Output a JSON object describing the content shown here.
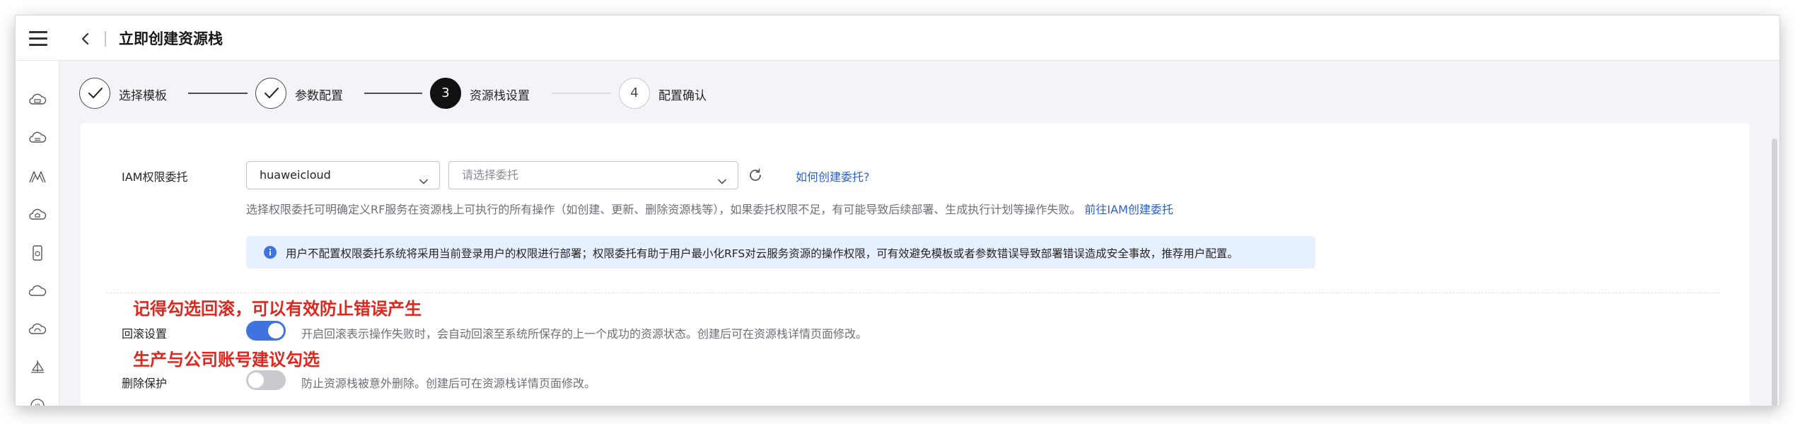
{
  "header": {
    "title": "立即创建资源栈",
    "menu_icon": "hamburger-menu-icon",
    "back_icon": "chevron-left-icon"
  },
  "sidebar": {
    "items": [
      {
        "icon": "cloud-server-icon"
      },
      {
        "icon": "cloud-database-icon"
      },
      {
        "icon": "mountain-icon"
      },
      {
        "icon": "cloud-home-icon"
      },
      {
        "icon": "device-icon"
      },
      {
        "icon": "cloud-outline-icon"
      },
      {
        "icon": "cloud-gear-icon"
      },
      {
        "icon": "sailboat-icon"
      },
      {
        "icon": "ip-icon"
      }
    ]
  },
  "steps": [
    {
      "number": "1",
      "label": "选择模板",
      "state": "done"
    },
    {
      "number": "2",
      "label": "参数配置",
      "state": "done"
    },
    {
      "number": "3",
      "label": "资源栈设置",
      "state": "current"
    },
    {
      "number": "4",
      "label": "配置确认",
      "state": "pending"
    }
  ],
  "iam": {
    "label": "IAM权限委托",
    "provider_value": "huaweicloud",
    "agency_placeholder": "请选择委托",
    "how_to_link": "如何创建委托?",
    "hint": "选择权限委托可明确定义RF服务在资源栈上可执行的所有操作（如创建、更新、删除资源栈等），如果委托权限不足，有可能导致后续部署、生成执行计划等操作失败。",
    "hint_link": "前往IAM创建委托",
    "info": "用户不配置权限委托系统将采用当前登录用户的权限进行部署；权限委托有助于用户最小化RFS对云服务资源的操作权限，可有效避免模板或者参数错误导致部署错误造成安全事故，推荐用户配置。"
  },
  "rollback": {
    "annotation": "记得勾选回滚，可以有效防止错误产生",
    "label": "回滚设置",
    "enabled": true,
    "description": "开启回滚表示操作失败时，会自动回滚至系统所保存的上一个成功的资源状态。创建后可在资源栈详情页面修改。"
  },
  "delete_protection": {
    "annotation": "生产与公司账号建议勾选",
    "label": "删除保护",
    "enabled": false,
    "description": "防止资源栈被意外删除。创建后可在资源栈详情页面修改。"
  },
  "colors": {
    "accent": "#3f74e0",
    "link": "#2d5fd3",
    "annotation": "#e0261d",
    "info_bg": "#e7f0fe"
  }
}
